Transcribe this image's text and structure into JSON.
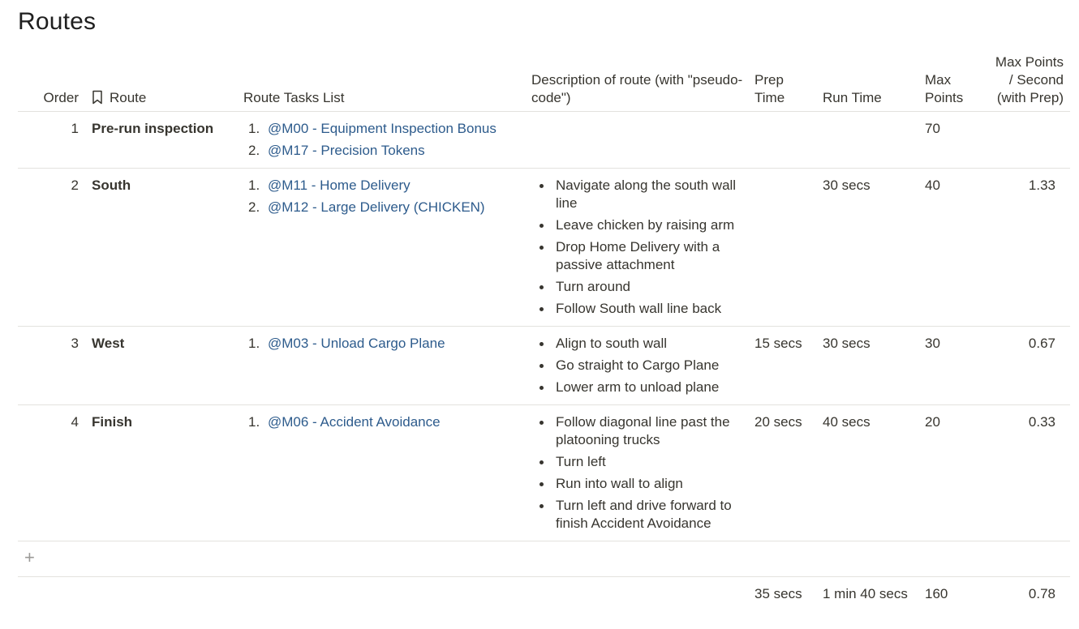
{
  "page": {
    "title": "Routes"
  },
  "table": {
    "headers": {
      "order": "Order",
      "route": "Route",
      "tasks": "Route Tasks List",
      "description": "Description of route (with \"pseudo-code\")",
      "prep_time": "Prep Time",
      "run_time": "Run Time",
      "max_points": "Max Points",
      "max_points_per_second": "Max Points / Second (with Prep)"
    },
    "rows": [
      {
        "order": "1",
        "route": "Pre-run inspection",
        "tasks": [
          "@M00 - Equipment Inspection Bonus",
          "@M17 - Precision Tokens"
        ],
        "description": [],
        "prep_time": "",
        "run_time": "",
        "max_points": "70",
        "max_points_per_second": ""
      },
      {
        "order": "2",
        "route": "South",
        "tasks": [
          "@M11 - Home Delivery",
          "@M12 - Large Delivery (CHICKEN)"
        ],
        "description": [
          "Navigate along the south wall line",
          "Leave chicken by raising arm",
          "Drop Home Delivery with a passive attachment",
          "Turn around",
          "Follow South wall line back"
        ],
        "prep_time": "",
        "run_time": "30 secs",
        "max_points": "40",
        "max_points_per_second": "1.33"
      },
      {
        "order": "3",
        "route": "West",
        "tasks": [
          "@M03 - Unload Cargo Plane"
        ],
        "description": [
          "Align to south wall",
          "Go straight to Cargo Plane",
          "Lower arm to unload plane"
        ],
        "prep_time": "15 secs",
        "run_time": "30 secs",
        "max_points": "30",
        "max_points_per_second": "0.67"
      },
      {
        "order": "4",
        "route": "Finish",
        "tasks": [
          "@M06 - Accident Avoidance"
        ],
        "description": [
          "Follow diagonal line past the platooning trucks",
          "Turn left",
          "Run into wall to align",
          "Turn left and drive forward to finish Accident Avoidance"
        ],
        "prep_time": "20 secs",
        "run_time": "40 secs",
        "max_points": "20",
        "max_points_per_second": "0.33"
      }
    ],
    "add_row_label": "+",
    "totals": {
      "prep_time": "35 secs",
      "run_time": "1 min 40 secs",
      "max_points": "160",
      "max_points_per_second": "0.78"
    }
  },
  "icons": {
    "route_header_icon": "bookmark-icon",
    "add_row_icon": "plus-icon"
  },
  "colors": {
    "link": "#2d5b8c",
    "text": "#37352f",
    "border": "#e3e2de",
    "muted": "#9b9a97"
  }
}
